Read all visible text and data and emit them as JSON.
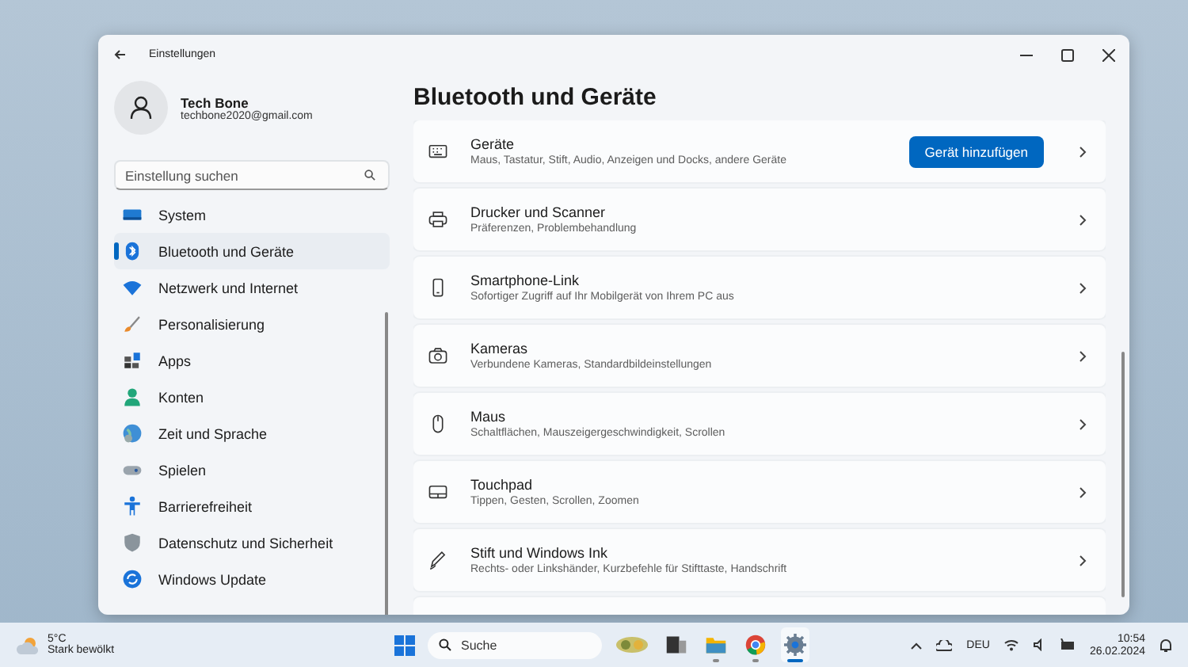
{
  "window": {
    "title": "Einstellungen"
  },
  "account": {
    "name": "Tech Bone",
    "email": "techbone2020@gmail.com"
  },
  "search": {
    "placeholder": "Einstellung suchen"
  },
  "sidebar": {
    "items": [
      {
        "kind": "system",
        "label": "System",
        "selected": false
      },
      {
        "kind": "bluetooth",
        "label": "Bluetooth und Geräte",
        "selected": true
      },
      {
        "kind": "network",
        "label": "Netzwerk und Internet",
        "selected": false
      },
      {
        "kind": "brush",
        "label": "Personalisierung",
        "selected": false
      },
      {
        "kind": "apps",
        "label": "Apps",
        "selected": false
      },
      {
        "kind": "person",
        "label": "Konten",
        "selected": false
      },
      {
        "kind": "globe",
        "label": "Zeit und Sprache",
        "selected": false
      },
      {
        "kind": "gamepad",
        "label": "Spielen",
        "selected": false
      },
      {
        "kind": "accessibility",
        "label": "Barrierefreiheit",
        "selected": false
      },
      {
        "kind": "shield",
        "label": "Datenschutz und Sicherheit",
        "selected": false
      },
      {
        "kind": "update",
        "label": "Windows Update",
        "selected": false
      }
    ]
  },
  "page": {
    "title": "Bluetooth und Geräte",
    "cards": [
      {
        "kind": "keyboard",
        "title": "Geräte",
        "subtitle": "Maus, Tastatur, Stift, Audio, Anzeigen und Docks, andere Geräte",
        "button": "Gerät hinzufügen"
      },
      {
        "kind": "printer",
        "title": "Drucker und Scanner",
        "subtitle": "Präferenzen, Problembehandlung"
      },
      {
        "kind": "phone",
        "title": "Smartphone-Link",
        "subtitle": "Sofortiger Zugriff auf Ihr Mobilgerät von Ihrem PC aus"
      },
      {
        "kind": "camera",
        "title": "Kameras",
        "subtitle": "Verbundene Kameras, Standardbildeinstellungen"
      },
      {
        "kind": "mouse",
        "title": "Maus",
        "subtitle": "Schaltflächen, Mauszeigergeschwindigkeit, Scrollen"
      },
      {
        "kind": "touchpad",
        "title": "Touchpad",
        "subtitle": "Tippen, Gesten, Scrollen, Zoomen"
      },
      {
        "kind": "pen",
        "title": "Stift und Windows Ink",
        "subtitle": "Rechts- oder Linkshänder, Kurzbefehle für Stifttaste, Handschrift"
      }
    ]
  },
  "taskbar": {
    "weather": {
      "temperature": "5°C",
      "condition": "Stark bewölkt"
    },
    "search": {
      "placeholder": "Suche"
    },
    "apps": [
      {
        "kind": "taskview",
        "running": false,
        "selected": false
      },
      {
        "kind": "explorer",
        "running": true,
        "selected": false
      },
      {
        "kind": "chrome",
        "running": true,
        "selected": false
      },
      {
        "kind": "settings",
        "running": true,
        "selected": true
      }
    ],
    "language": "DEU",
    "time": "10:54",
    "date": "26.02.2024"
  }
}
